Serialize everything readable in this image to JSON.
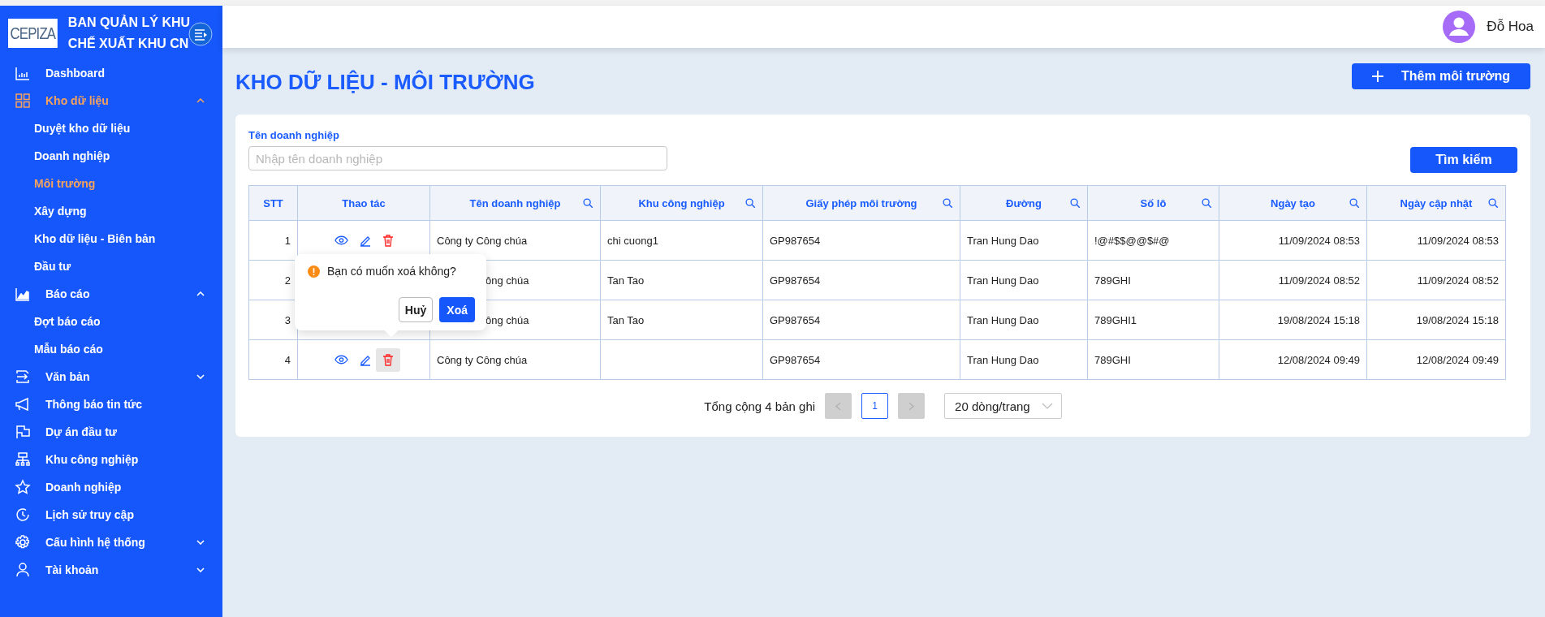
{
  "sidebar": {
    "logo": "CEPIZA",
    "title_lines": [
      "BAN QUẢN LÝ KHU",
      "CHẾ XUẤT KHU CN"
    ],
    "items": [
      {
        "label": "Dashboard",
        "selected": false
      },
      {
        "label": "Kho dữ liệu",
        "selected": true,
        "expanded": true,
        "children": [
          {
            "label": "Duyệt kho dữ liệu",
            "selected": false
          },
          {
            "label": "Doanh nghiệp",
            "selected": false
          },
          {
            "label": "Môi trường",
            "selected": true
          },
          {
            "label": "Xây dựng",
            "selected": false
          },
          {
            "label": "Kho dữ liệu - Biên bản",
            "selected": false
          },
          {
            "label": "Đầu tư",
            "selected": false
          }
        ]
      },
      {
        "label": "Báo cáo",
        "selected": false,
        "expanded": true,
        "children": [
          {
            "label": "Đợt báo cáo",
            "selected": false
          },
          {
            "label": "Mẫu báo cáo",
            "selected": false
          }
        ]
      },
      {
        "label": "Văn bản",
        "selected": false,
        "expanded": false
      },
      {
        "label": "Thông báo tin tức",
        "selected": false
      },
      {
        "label": "Dự án đầu tư",
        "selected": false
      },
      {
        "label": "Khu công nghiệp",
        "selected": false
      },
      {
        "label": "Doanh nghiệp",
        "selected": false
      },
      {
        "label": "Lịch sử truy cập",
        "selected": false
      },
      {
        "label": "Cấu hình hệ thống",
        "selected": false,
        "expanded": false
      },
      {
        "label": "Tài khoản",
        "selected": false,
        "expanded": false
      }
    ]
  },
  "header": {
    "user": "Đỗ Hoa"
  },
  "page_title": "KHO DỮ LIỆU - MÔI TRƯỜNG",
  "add_button": "Thêm môi trường",
  "filter": {
    "label": "Tên doanh nghiệp",
    "placeholder": "Nhập tên doanh nghiệp",
    "button": "Tìm kiếm"
  },
  "table": {
    "columns": [
      {
        "label": "STT",
        "searchable": false
      },
      {
        "label": "Thao tác",
        "searchable": false
      },
      {
        "label": "Tên doanh nghiệp",
        "searchable": true
      },
      {
        "label": "Khu công nghiệp",
        "searchable": true
      },
      {
        "label": "Giấy phép môi trường",
        "searchable": true
      },
      {
        "label": "Đường",
        "searchable": true
      },
      {
        "label": "Số lô",
        "searchable": true
      },
      {
        "label": "Ngày tạo",
        "searchable": true
      },
      {
        "label": "Ngày cập nhật",
        "searchable": true
      }
    ],
    "rows": [
      {
        "stt": "1",
        "actions_visible": true,
        "delete_active": false,
        "name": "Công ty Công chúa",
        "zone": "chi cuong1",
        "permit": "GP987654",
        "street": "Tran Hung Dao",
        "lot": "!@#$$@@$#@",
        "created": "11/09/2024 08:53",
        "updated": "11/09/2024 08:53"
      },
      {
        "stt": "2",
        "actions_visible": false,
        "delete_active": false,
        "name": "ông chúa",
        "zone": "Tan Tao",
        "permit": "GP987654",
        "street": "Tran Hung Dao",
        "lot": "789GHI",
        "created": "11/09/2024 08:52",
        "updated": "11/09/2024 08:52"
      },
      {
        "stt": "3",
        "actions_visible": false,
        "delete_active": false,
        "name": "ông chúa",
        "zone": "Tan Tao",
        "permit": "GP987654",
        "street": "Tran Hung Dao",
        "lot": "789GHI1",
        "created": "19/08/2024 15:18",
        "updated": "19/08/2024 15:18"
      },
      {
        "stt": "4",
        "actions_visible": true,
        "delete_active": true,
        "name": "Công ty Công chúa",
        "permit": "GP987654",
        "street": "Tran Hung Dao",
        "lot": "789GHI",
        "created": "12/08/2024 09:49",
        "updated": "12/08/2024 09:49"
      }
    ]
  },
  "confirm_popup": {
    "message": "Bạn có muốn xoá không?",
    "cancel": "Huỷ",
    "confirm": "Xoá"
  },
  "pagination": {
    "total": "Tổng cộng 4 bản ghi",
    "prev_disabled": true,
    "page": "1",
    "next_disabled": true,
    "page_size": "20 dòng/trang"
  }
}
